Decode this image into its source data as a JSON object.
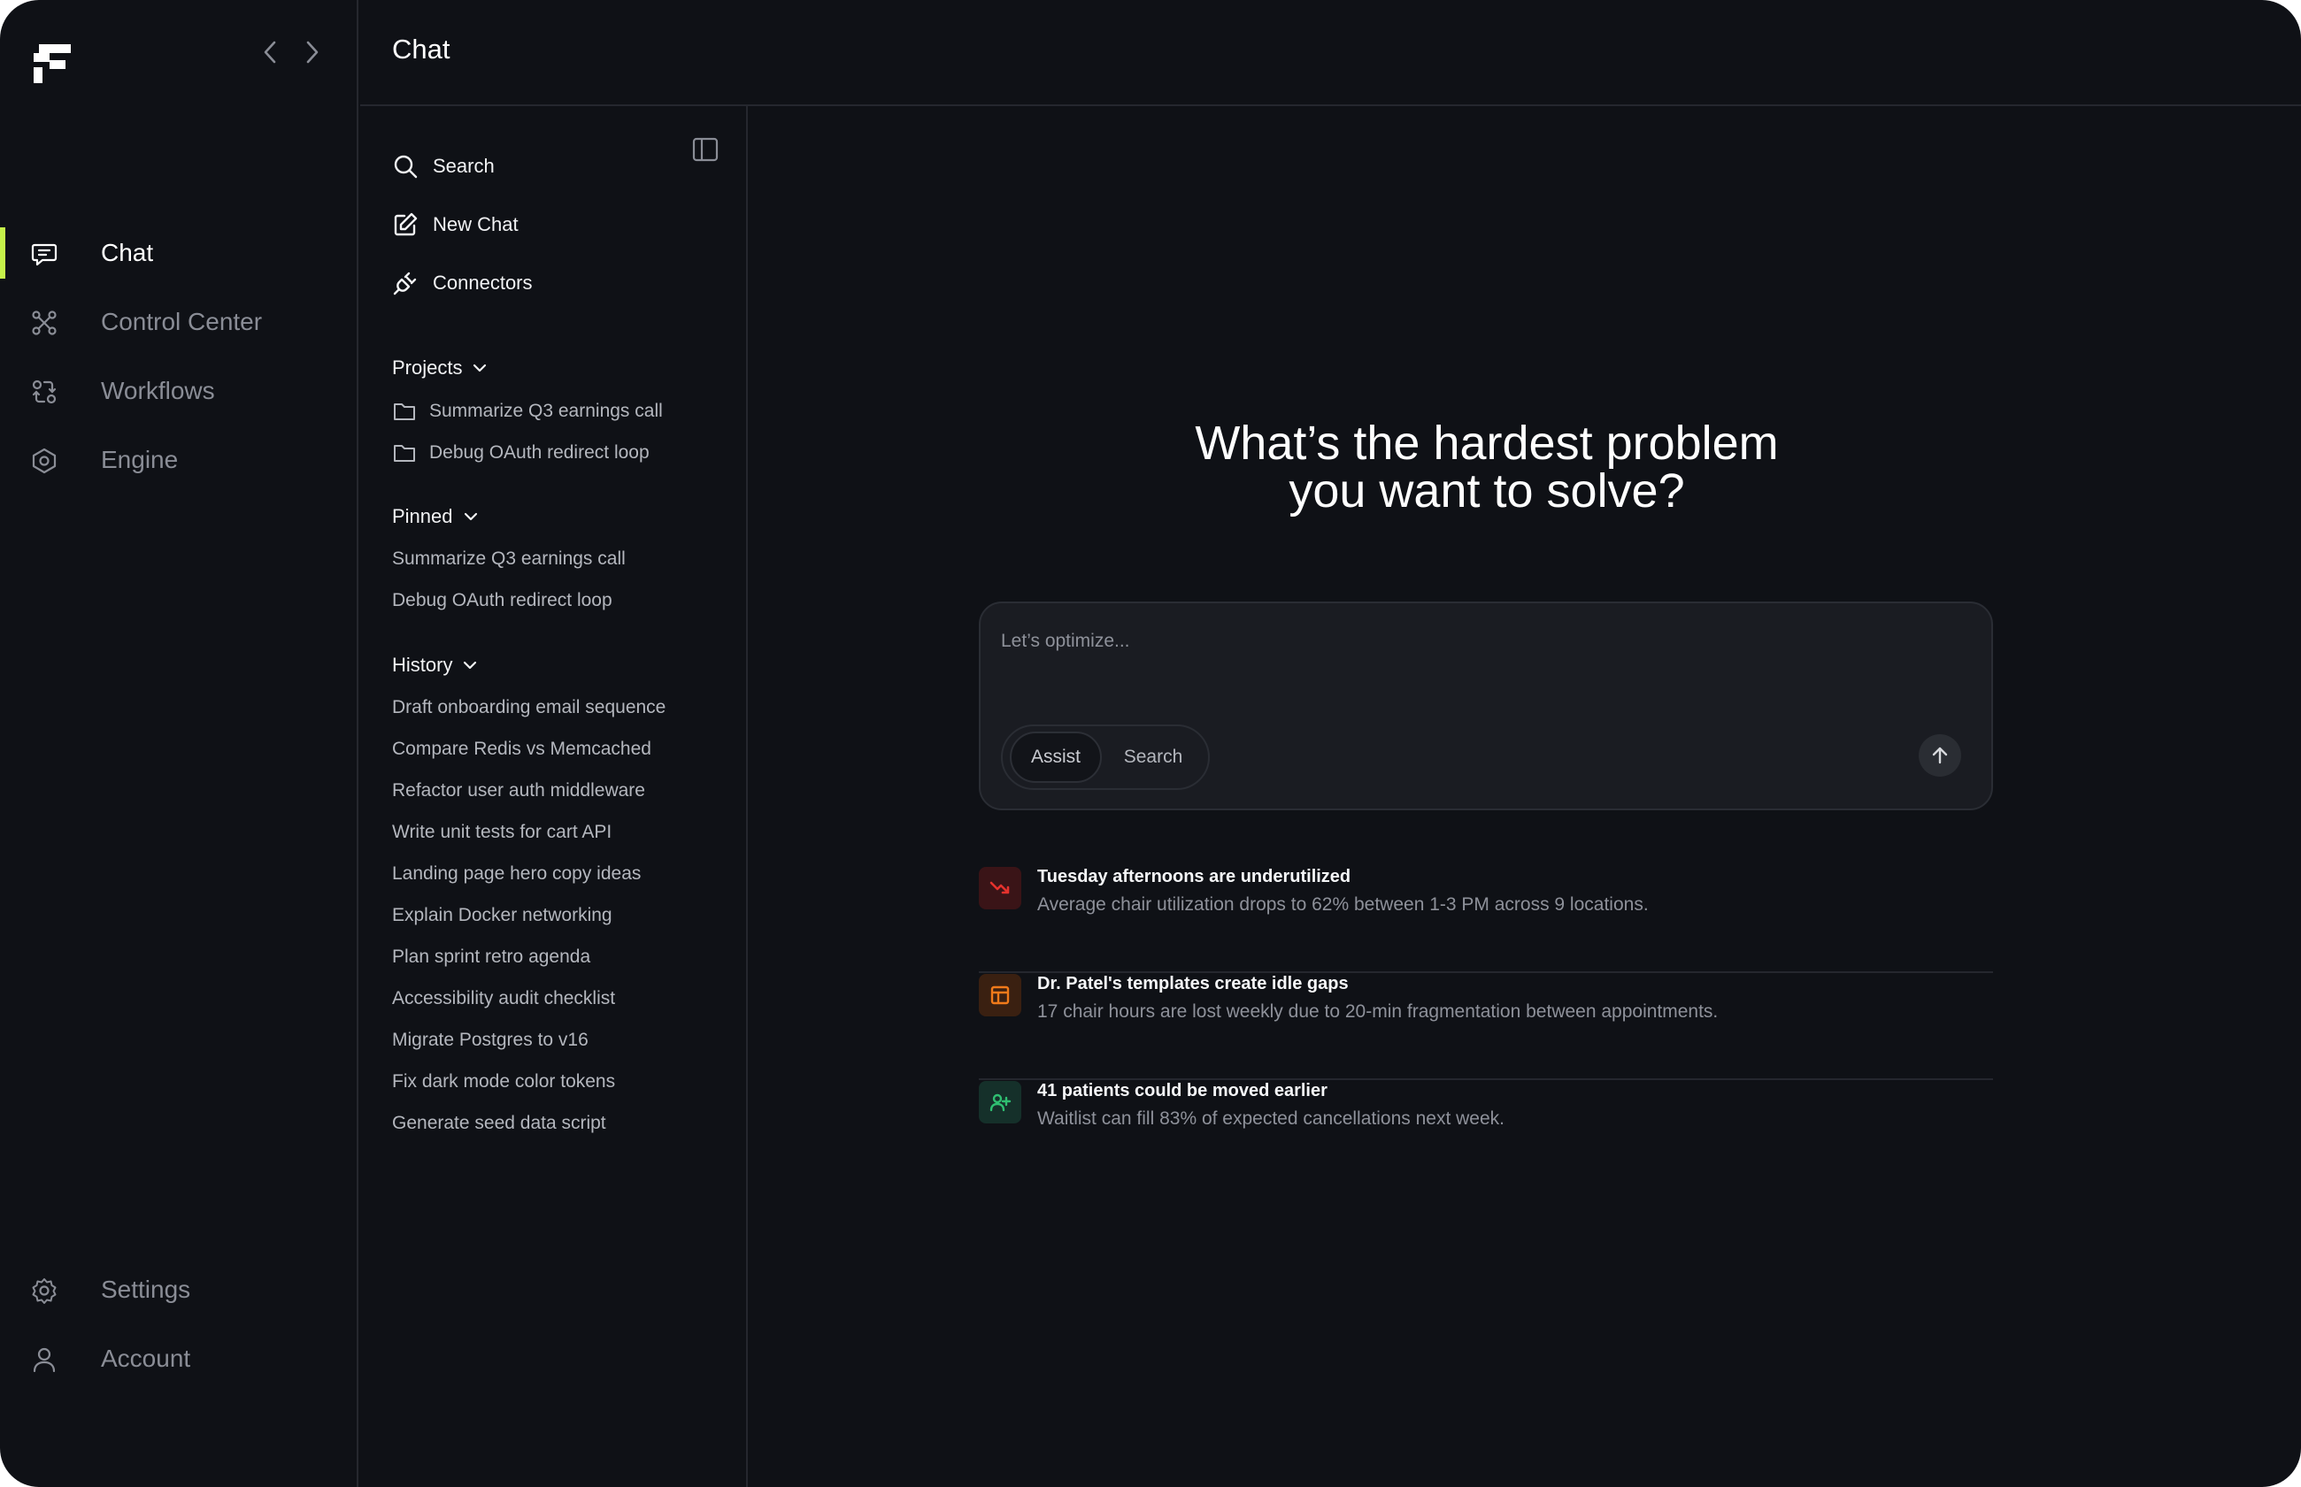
{
  "nav": {
    "items": [
      {
        "label": "Chat",
        "icon": "chat-icon",
        "active": true
      },
      {
        "label": "Control Center",
        "icon": "nodes-icon"
      },
      {
        "label": "Workflows",
        "icon": "workflow-icon"
      },
      {
        "label": "Engine",
        "icon": "hexagon-icon"
      }
    ],
    "bottom": [
      {
        "label": "Settings",
        "icon": "gear-icon"
      },
      {
        "label": "Account",
        "icon": "user-icon"
      }
    ],
    "accent_color": "#c6f24a"
  },
  "header": {
    "title": "Chat"
  },
  "panel": {
    "actions": {
      "search": "Search",
      "new_chat": "New Chat",
      "connectors": "Connectors"
    },
    "projects": {
      "title": "Projects",
      "items": [
        "Summarize Q3 earnings call",
        "Debug OAuth redirect loop"
      ]
    },
    "pinned": {
      "title": "Pinned",
      "items": [
        "Summarize Q3 earnings call",
        "Debug OAuth redirect loop"
      ]
    },
    "history": {
      "title": "History",
      "items": [
        "Draft onboarding email sequence",
        "Compare Redis vs Memcached",
        "Refactor user auth middleware",
        "Write unit tests for cart API",
        "Landing page hero copy ideas",
        "Explain Docker networking",
        "Plan sprint retro agenda",
        "Accessibility audit checklist",
        "Migrate Postgres to v16",
        "Fix dark mode color tokens",
        "Generate seed data script"
      ]
    }
  },
  "main": {
    "headline_line1": "What’s the hardest problem",
    "headline_line2": "you want to solve?",
    "composer": {
      "placeholder": "Let’s optimize...",
      "modes": [
        "Assist",
        "Search"
      ],
      "active_mode": "Assist"
    },
    "insights": [
      {
        "title": "Tuesday afternoons are underutilized",
        "description": "Average chair utilization drops to 62% between 1-3 PM across 9 locations.",
        "icon": "trending-down-icon",
        "color": "#e5322d"
      },
      {
        "title": "Dr. Patel's templates create idle gaps",
        "description": "17 chair hours are lost weekly due to 20-min fragmentation between appointments.",
        "icon": "layout-icon",
        "color": "#f07a1a"
      },
      {
        "title": "41 patients could be moved earlier",
        "description": "Waitlist can fill 83% of expected cancellations next week.",
        "icon": "user-plus-icon",
        "color": "#2fbf71"
      }
    ]
  }
}
